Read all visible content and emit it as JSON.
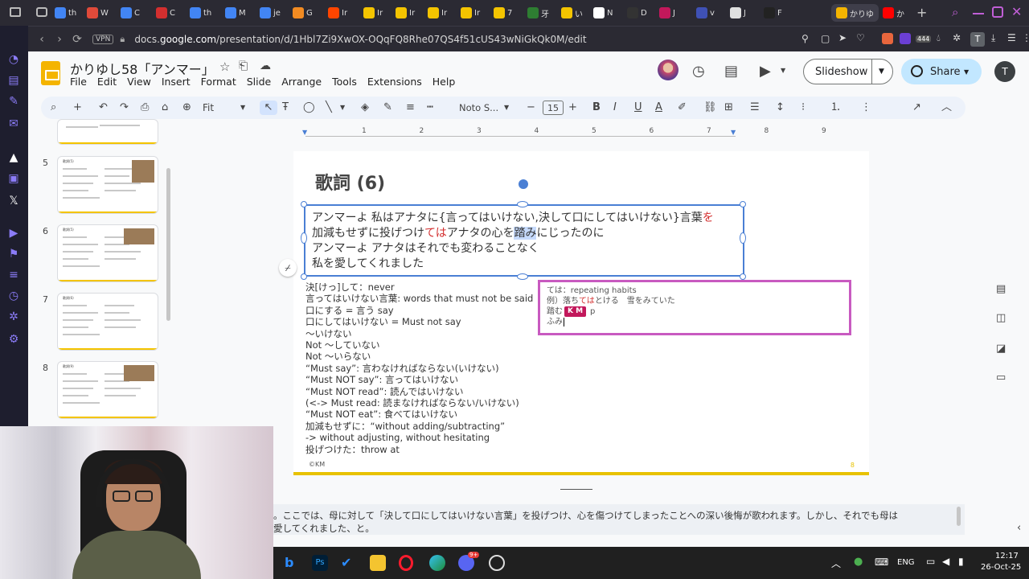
{
  "browser": {
    "tabs": [
      {
        "label": "th",
        "color": "#4285f4"
      },
      {
        "label": "W",
        "color": "#e04a3a"
      },
      {
        "label": "C",
        "color": "#4285f4"
      },
      {
        "label": "C",
        "color": "#d32f2f"
      },
      {
        "label": "th",
        "color": "#4285f4"
      },
      {
        "label": "M",
        "color": "#4285f4"
      },
      {
        "label": "je",
        "color": "#4285f4"
      },
      {
        "label": "G",
        "color": "#f28b22"
      },
      {
        "label": "Ir",
        "color": "#ff4500"
      },
      {
        "label": "Ir",
        "color": "#f4c400"
      },
      {
        "label": "Ir",
        "color": "#f4c400"
      },
      {
        "label": "Ir",
        "color": "#f4c400"
      },
      {
        "label": "Ir",
        "color": "#f4c400"
      },
      {
        "label": "7",
        "color": "#f4c400"
      },
      {
        "label": "牙",
        "color": "#2e7d32"
      },
      {
        "label": "い",
        "color": "#f4c400"
      },
      {
        "label": "N",
        "color": "#ffffff"
      },
      {
        "label": "D",
        "color": "#333333"
      },
      {
        "label": "J",
        "color": "#c2185b"
      },
      {
        "label": "v",
        "color": "#3f51b5"
      },
      {
        "label": "J",
        "color": "#e0e0e0"
      },
      {
        "label": "F",
        "color": "#222222"
      }
    ],
    "active_tab": "かりゆ",
    "last_tab": "か",
    "url_prefix": "docs.",
    "url_domain": "google.com",
    "url_path": "/presentation/d/1Hbl7Zi9XwOX-OQqFQ8Rhe07QS4f51cUS43wNiGkQk0M/edit",
    "vpn_label": "VPN",
    "badge_count": "444",
    "profile_letter": "T"
  },
  "docs": {
    "title": "かりゆし58「アンマー」",
    "menu": [
      "File",
      "Edit",
      "View",
      "Insert",
      "Format",
      "Slide",
      "Arrange",
      "Tools",
      "Extensions",
      "Help"
    ],
    "slideshow_label": "Slideshow",
    "share_label": "Share",
    "avatar_letter": "T",
    "toolbar": {
      "zoom": "Fit",
      "font": "Noto S...",
      "font_size": "15"
    }
  },
  "slides_panel": {
    "slides": [
      {
        "number": "5",
        "title": "歌詞(5)"
      },
      {
        "number": "6",
        "title": "歌詞(5)"
      },
      {
        "number": "7",
        "title": "歌詞(6)"
      },
      {
        "number": "8",
        "title": "歌詞(9)"
      }
    ]
  },
  "ruler": [
    "1",
    "2",
    "3",
    "4",
    "5",
    "6",
    "7",
    "8",
    "9"
  ],
  "slide": {
    "title": "歌詞 (6)",
    "lyrics": {
      "line1_a": "アンマーよ 私はアナタに{言ってはいけない,決して口にしてはいけない}言葉",
      "line1_red": "を",
      "line2_a": "加減もせずに投げつけ",
      "line2_red": "ては",
      "line2_b": "アナタの心を",
      "line2_hl": "踏み",
      "line2_c": "にじったのに",
      "line3": "アンマーよ アナタはそれでも変わることなく",
      "line4": "私を愛してくれました"
    },
    "notes": [
      "決[けっ]して：never",
      "言ってはいけない言葉: words that must not be said",
      "口にする = 言う say",
      "口にしてはいけない = Must not say",
      "〜いけない",
      "Not 〜していない",
      "Not 〜いらない",
      "“Must say”:  言わなければならない(いけない)",
      "“Must NOT say”: 言ってはいけない",
      "“Must NOT read”: 読んではいけない",
      "(<-> Must read: 読まなければならない/いけない)",
      "“Must NOT eat”: 食べてはいけない",
      "加減もせずに：“without adding/subtracting”",
      "-> without adjusting, without hesitating",
      "投げつけた：throw at"
    ],
    "popup": {
      "line1": "ては：repeating habits",
      "line2_a": "例）落ち",
      "line2_red": "ては",
      "line2_b": "とける　雪をみていた",
      "line3": "踏む",
      "line3_tail": "p",
      "line4": "ふみ",
      "badge": "K M"
    },
    "footer": "©KM",
    "page_number": "8"
  },
  "speaker_notes": {
    "line1": "。ここでは、母に対して「決して口にしてはいけない言葉」を投げつけ、心を傷つけてしまったことへの深い後悔が歌われます。しかし、それでも母は",
    "line2": "愛してくれました、と。"
  },
  "taskbar": {
    "lang": "ENG",
    "time": "12:17",
    "date": "26-Oct-25",
    "discord_badge": "9+"
  }
}
